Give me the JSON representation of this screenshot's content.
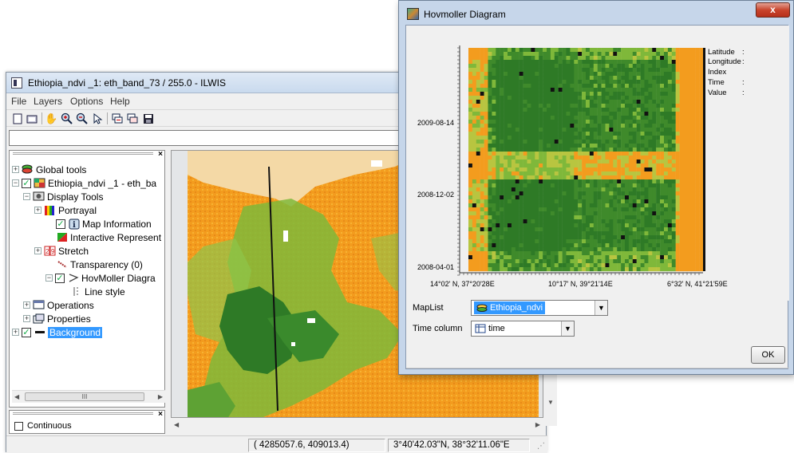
{
  "main_window": {
    "title": "Ethiopia_ndvi _1: eth_band_73 / 255.0 - ILWIS",
    "menu": [
      "File",
      "Layers",
      "Options",
      "Help"
    ],
    "toolbar_icons": [
      "new-map-icon",
      "open-icon",
      "pan-hand-icon",
      "zoom-in-icon",
      "zoom-out-icon",
      "select-arrow-icon",
      "add-layer-icon",
      "remove-layer-icon",
      "save-icon"
    ],
    "command_line_value": ""
  },
  "tree": {
    "global_tools": "Global tools",
    "map_layer": "Ethiopia_ndvi _1 - eth_ba",
    "display_tools": "Display Tools",
    "portrayal": "Portrayal",
    "map_information": "Map Information",
    "interactive_representation": "Interactive Represent",
    "stretch": "Stretch",
    "transparency": "Transparency (0)",
    "hovmoller": "HovMoller Diagra",
    "line_style": "Line style",
    "operations": "Operations",
    "properties": "Properties",
    "background": "Background",
    "scroll_thumb": "III"
  },
  "lower_panel": {
    "continuous_label": "Continuous"
  },
  "status": {
    "xy": "( 4285057.6,   409013.4)",
    "latlon": "3°40'42.03\"N, 38°32'11.06\"E"
  },
  "hovmoller": {
    "title": "Hovmoller Diagram",
    "close_label": "x",
    "y_ticks": [
      "2009-08-14",
      "2008-12-02",
      "2008-04-01"
    ],
    "x_ticks": [
      "14°02' N, 37°20'28E",
      "10°17' N, 39°21'14E",
      "6°32' N, 41°21'59E"
    ],
    "info": [
      {
        "label": "Latitude",
        "sep": ":"
      },
      {
        "label": "Longitude",
        "sep": ":"
      },
      {
        "label": "Index",
        "sep": ""
      },
      {
        "label": "Time",
        "sep": ":"
      },
      {
        "label": "Value",
        "sep": ":"
      }
    ],
    "maplist_label": "MapList",
    "maplist_value": "Ethiopia_ndvi",
    "time_column_label": "Time column",
    "time_column_value": "time",
    "ok_label": "OK"
  },
  "colors": {
    "ndvi_orange": "#f39c1e",
    "ndvi_light_green": "#7fb83a",
    "ndvi_dark_green": "#2e7a26",
    "selection_blue": "#3399ff"
  }
}
